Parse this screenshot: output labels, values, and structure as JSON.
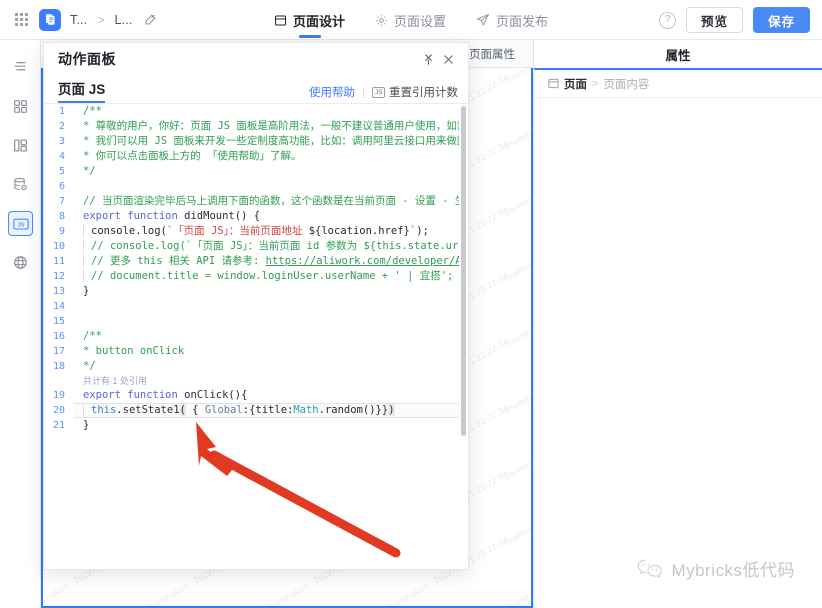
{
  "topbar": {
    "apps_icon": "apps-grid-icon",
    "app_icon": "app-logo-icon",
    "breadcrumb": {
      "app_name": "T...",
      "separator": ">",
      "page_name": "L...",
      "edit_icon": "edit-pencil-icon"
    },
    "nav": [
      {
        "label": "页面设计",
        "icon": "layout-icon",
        "active": true
      },
      {
        "label": "页面设置",
        "icon": "gear-icon",
        "active": false
      },
      {
        "label": "页面发布",
        "icon": "paper-plane-icon",
        "active": false
      }
    ],
    "help_icon": "question-circle-icon",
    "preview_label": "预览",
    "save_label": "保存"
  },
  "sidebar": {
    "items": [
      {
        "name": "outline",
        "icon": "outline-tree-icon",
        "active": false
      },
      {
        "name": "components",
        "icon": "grid-components-icon",
        "active": false
      },
      {
        "name": "layout",
        "icon": "layout-columns-icon",
        "active": false
      },
      {
        "name": "data",
        "icon": "database-gear-icon",
        "active": false
      },
      {
        "name": "js",
        "icon": "js-script-icon",
        "active": true
      },
      {
        "name": "global",
        "icon": "globe-icon",
        "active": false
      }
    ]
  },
  "stage": {
    "tabs": [
      {
        "label": "页面属性"
      }
    ],
    "canvas_chip": {
      "icon": "page-content-icon",
      "label": "页面内容"
    },
    "watermark_text": "chemingkun · 2022/05/31 22:22:34"
  },
  "right_panel": {
    "title": "属性",
    "breadcrumb": {
      "icon": "page-icon",
      "root": "页面",
      "separator": ">",
      "current": "页面内容"
    }
  },
  "action_panel": {
    "title": "动作面板",
    "pin_icon": "pin-icon",
    "close_icon": "close-icon",
    "tab_label": "页面 JS",
    "help_link": "使用帮助",
    "reset_icon": "js-badge-icon",
    "reset_label": "重置引用计数",
    "scrollbar": "vertical-scrollbar"
  },
  "code": {
    "codelens_label": "共计有 1 处引用",
    "lines": [
      {
        "n": "1",
        "html": "<span class=\"t-cmt\">/**</span>"
      },
      {
        "n": "2",
        "html": "<span class=\"t-cmt\">* 尊敬的用户，你好：页面 JS 面板是高阶用法，一般不建议普通用户使用，如需</span>"
      },
      {
        "n": "3",
        "html": "<span class=\"t-cmt\">* 我们可以用 JS 面板来开发一些定制度高功能，比如：调用阿里云接口用来做图</span>"
      },
      {
        "n": "4",
        "html": "<span class=\"t-cmt\">* 你可以点击面板上方的 「使用帮助」了解。</span>"
      },
      {
        "n": "5",
        "html": "<span class=\"t-cmt\">*/</span>"
      },
      {
        "n": "6",
        "html": ""
      },
      {
        "n": "7",
        "html": "<span class=\"t-cmt\">// 当页面渲染完毕后马上调用下面的函数，这个函数是在当前页面 - 设置 - 生</span>"
      },
      {
        "n": "8",
        "html": "<span class=\"t-kw\">export function</span> <span class=\"t-fn\">didMount</span><span class=\"t-plain\">() {</span>"
      },
      {
        "n": "9",
        "html": "<span class=\"guide\"></span><span class=\"t-plain\">console.log(</span><span class=\"t-str\">`「页面 JS」：当前页面地址 </span><span class=\"t-plain\">${location.href}</span><span class=\"t-str\">`</span><span class=\"t-plain\">);</span>"
      },
      {
        "n": "10",
        "html": "<span class=\"guide\"></span><span class=\"t-cmt\">// console.log(`「页面 JS」：当前页面 id 参数为 ${this.state.ur</span>"
      },
      {
        "n": "11",
        "html": "<span class=\"guide\"></span><span class=\"t-cmt\">// 更多 this 相关 API 请参考: </span><span class=\"t-link\">https://aliwork.com/developer/AI</span>"
      },
      {
        "n": "12",
        "html": "<span class=\"guide\"></span><span class=\"t-cmt\">// document.title = window.loginUser.userName + ' | 宜搭';</span>"
      },
      {
        "n": "13",
        "html": "<span class=\"t-plain\">}</span>"
      },
      {
        "n": "14",
        "html": ""
      },
      {
        "n": "15",
        "html": ""
      },
      {
        "n": "16",
        "html": "<span class=\"t-cmt\">/**</span>"
      },
      {
        "n": "17",
        "html": "<span class=\"t-cmt\">* button onClick</span>"
      },
      {
        "n": "18",
        "html": "<span class=\"t-cmt\">*/</span>"
      },
      {
        "n": "19",
        "html": "<span class=\"t-kw\">export function</span> <span class=\"t-fn\">onClick</span><span class=\"t-plain\">(){</span>"
      },
      {
        "n": "20",
        "html": "<span class=\"guide\"></span><span class=\"t-this\">this</span><span class=\"t-plain\">.</span><span class=\"t-fn\">setState1</span><span class=\"sel-paren\">(</span><span class=\"t-plain\"> { </span><span class=\"t-id\">Global</span><span class=\"t-plain\">:{title:</span><span class=\"t-cls\">Math</span><span class=\"t-plain\">.random()}}</span><span class=\"sel-paren\">)</span>"
      },
      {
        "n": "21",
        "html": "<span class=\"t-plain\">}</span>"
      }
    ],
    "codelens_after_line": "18"
  },
  "annotation": {
    "arrow_color": "#e03a22",
    "arrow_name": "red-pointer-arrow"
  },
  "brandmark": {
    "icon": "wechat-icon",
    "text": "Mybricks低代码"
  }
}
